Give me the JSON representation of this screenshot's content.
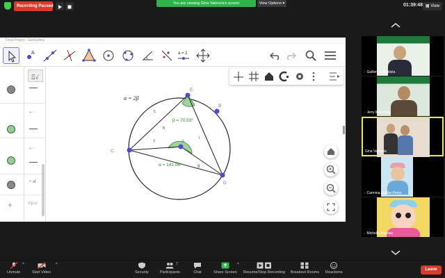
{
  "topbar": {
    "recording": "Recording Paused",
    "banner": "You are viewing Gina Valencia's screen",
    "view_options": "View Options",
    "time": "01:39:48",
    "view": "View"
  },
  "geogebra": {
    "title": "Final Project - GeoGebra",
    "algebra_input_placeholder": "Input",
    "graphics": {
      "formula": "α = 2β",
      "points": [
        "A",
        "B",
        "C",
        "D",
        "E"
      ],
      "segments": [
        "c",
        "h",
        "f",
        "i",
        "g"
      ],
      "beta_label": "β = 70.53°",
      "alpha_label": "α = 141.06°"
    },
    "colors": {
      "accent": "#7a7ae0",
      "point": "#4a4ad8",
      "angle": "#2e8b2e"
    }
  },
  "participants": [
    {
      "name": "Guillermo Bautista",
      "muted": true,
      "active": false
    },
    {
      "name": "Jerry Maramag",
      "muted": true,
      "active": false
    },
    {
      "name": "Gina Valencia",
      "muted": false,
      "active": true
    },
    {
      "name": "Carmina Aguilar-Perez",
      "muted": true,
      "active": false
    },
    {
      "name": "Michelle Angeles",
      "muted": true,
      "active": false
    }
  ],
  "toolbar": {
    "unmute": "Unmute",
    "start_video": "Start Video",
    "security": "Security",
    "participants": "Participants",
    "participants_count": "7",
    "chat": "Chat",
    "share_screen": "Share Screen",
    "record": "Resume/Stop Recording",
    "breakout": "Breakout Rooms",
    "reactions": "Reactions",
    "leave": "Leave"
  }
}
